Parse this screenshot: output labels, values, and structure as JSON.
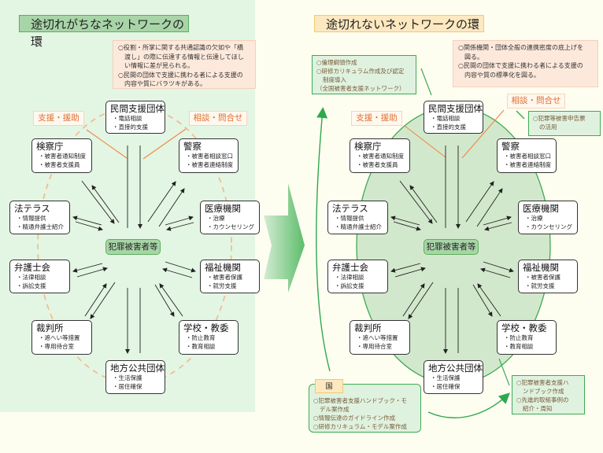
{
  "left": {
    "title": "途切れがちなネットワークの環",
    "note": [
      "○役割・所掌に関する共通認識の欠如や「橋",
      "渡し」の際に伝達する情報と伝達してほし",
      "い情報に差が見られる。",
      "○民間の団体で支援に携わる者による支援の",
      "内容や質にバラツキがある。"
    ]
  },
  "right": {
    "title": "途切れないネットワークの環",
    "note": [
      "○関係機関・団体全般の連携密度の底上げを",
      "図る。",
      "○民間の団体で支援に携わる者による支援の",
      "内容や質の標準化を図る。"
    ],
    "network_note": [
      "○倫理綱領作成",
      "○研修カリキュラム作成及び認定",
      "制度導入",
      "（全国被害者支援ネットワーク）"
    ],
    "police_note": [
      "○犯罪等被害申告票",
      "の活用"
    ],
    "kuni_label": "国",
    "kuni_note": [
      "○犯罪被害者支援ハンドブック・モ",
      "デル案作成",
      "○情報伝達のガイドライン作成",
      "○研修カリキュラム・モデル案作成"
    ],
    "local_note": [
      "○犯罪被害者支援ハ",
      "ンドブック作成",
      "○先進的取組事例の",
      "紹介・周知"
    ]
  },
  "labels": {
    "support": "支援・援助",
    "consult": "相談・問合せ"
  },
  "center": "犯罪被害者等",
  "nodes": {
    "minkan": {
      "name": "民間支援団体",
      "items": [
        "・電話相談",
        "・直接的支援"
      ]
    },
    "kensatsu": {
      "name": "検察庁",
      "items": [
        "・被害者通知制度",
        "・被害者支援員"
      ]
    },
    "keisatsu": {
      "name": "警察",
      "items": [
        "・被害者相談窓口",
        "・被害者連絡制度"
      ]
    },
    "houterasu": {
      "name": "法テラス",
      "items": [
        "・情報提供",
        "・精通弁護士紹介"
      ]
    },
    "iryou": {
      "name": "医療機関",
      "items": [
        "・治療",
        "・カウンセリング"
      ]
    },
    "bengoshi": {
      "name": "弁護士会",
      "items": [
        "・法律相談",
        "・訴訟支援"
      ]
    },
    "fukushi": {
      "name": "福祉機関",
      "items": [
        "・被害者保護",
        "・就労支援"
      ]
    },
    "saibansho": {
      "name": "裁判所",
      "items": [
        "・遮へい等措置",
        "・専用待合室"
      ]
    },
    "gakkou": {
      "name": "学校・教委",
      "items": [
        "・防止教育",
        "・教育相談"
      ]
    },
    "chihou": {
      "name": "地方公共団体",
      "items": [
        "・生活保護",
        "・居住確保"
      ]
    }
  },
  "colors": {
    "left_bg": "#e3f5e3",
    "page_bg": "#fefef0",
    "green_accent": "#3eaa55",
    "orange_accent": "#e07030",
    "dashed_ring": "#f5b888",
    "ring_fill": "#d2e8cc"
  }
}
